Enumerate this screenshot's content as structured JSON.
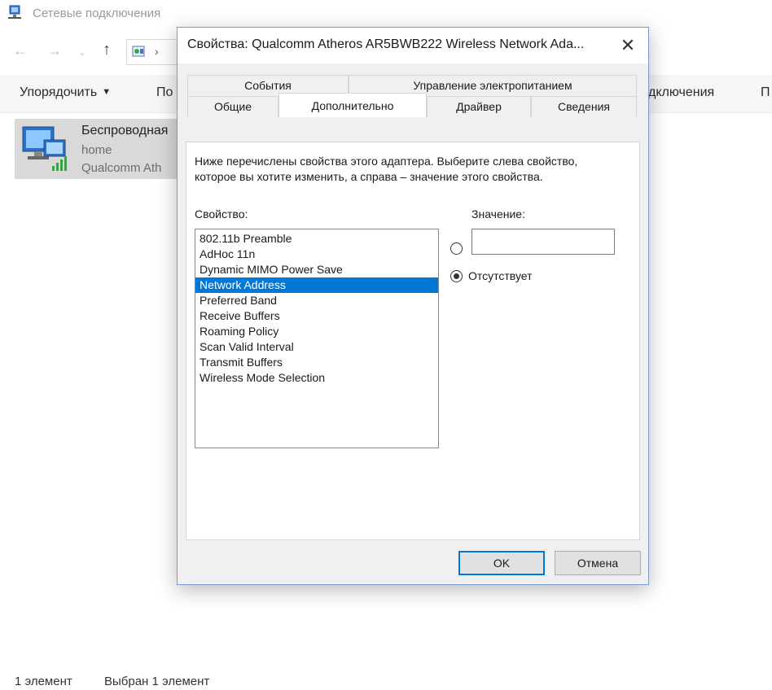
{
  "explorer": {
    "title": "Сетевые подключения",
    "address_sep": "›",
    "ribbon": [
      {
        "label": "Упорядочить",
        "has_dropdown": true
      },
      {
        "label": "По"
      },
      {
        "label": "дключения"
      },
      {
        "label": "П"
      }
    ],
    "item": {
      "name": "Беспроводная",
      "network": "home",
      "adapter": "Qualcomm Ath"
    },
    "status": {
      "count": "1 элемент",
      "selected": "Выбран 1 элемент"
    }
  },
  "dialog": {
    "title": "Свойства: Qualcomm Atheros AR5BWB222 Wireless Network Ada...",
    "close_glyph": "✕",
    "tabs_top": [
      {
        "label": "События"
      },
      {
        "label": "Управление электропитанием"
      }
    ],
    "tabs_bottom": [
      {
        "label": "Общие"
      },
      {
        "label": "Дополнительно",
        "active": true
      },
      {
        "label": "Драйвер"
      },
      {
        "label": "Сведения"
      }
    ],
    "description": "Ниже перечислены свойства этого адаптера. Выберите слева свойство, которое вы хотите изменить, а справа – значение этого свойства.",
    "property_label": "Свойство:",
    "value_label": "Значение:",
    "properties": [
      "802.11b Preamble",
      "AdHoc 11n",
      "Dynamic MIMO Power Save",
      "Network Address",
      "Preferred Band",
      "Receive Buffers",
      "Roaming Policy",
      "Scan Valid Interval",
      "Transmit Buffers",
      "Wireless Mode Selection"
    ],
    "selected_property": "Network Address",
    "value_input": "",
    "absent_label": "Отсутствует",
    "absent_selected": true,
    "ok_label": "OK",
    "cancel_label": "Отмена"
  },
  "colors": {
    "selection": "#0078d7",
    "tile_selected": "#d9d9d9",
    "default_button_border": "#0078d7"
  }
}
